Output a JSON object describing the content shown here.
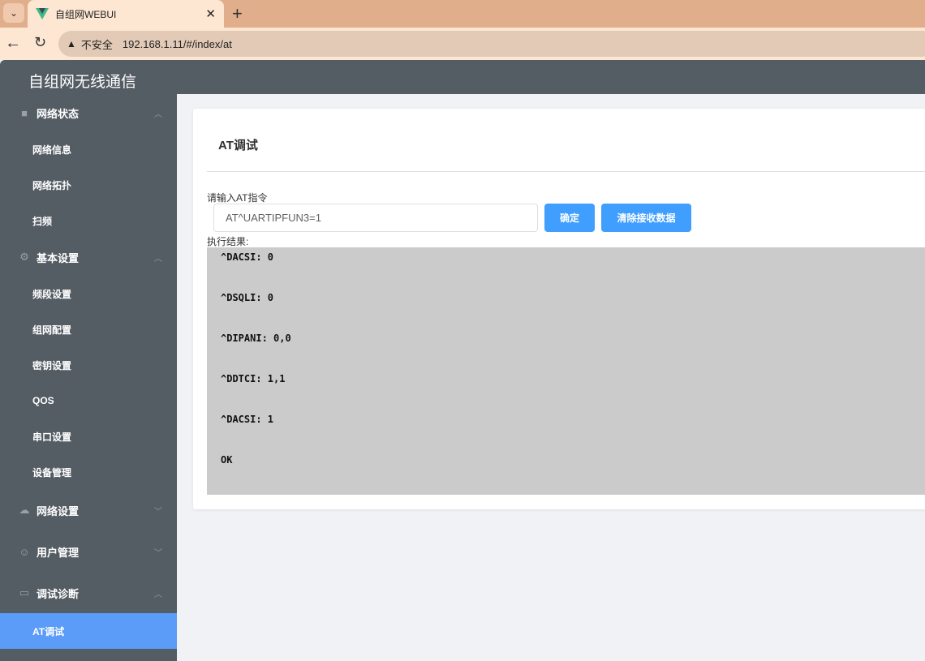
{
  "browser": {
    "tab_title": "自组网WEBUI",
    "insecure_label": "不安全",
    "url": "192.168.1.11/#/index/at"
  },
  "app": {
    "title": "自组网无线通信"
  },
  "sidebar": {
    "groups": [
      {
        "label": "网络状态",
        "icon": "camera-icon",
        "expanded": true,
        "items": [
          "网络信息",
          "网络拓扑",
          "扫频"
        ]
      },
      {
        "label": "基本设置",
        "icon": "gear-icon",
        "expanded": true,
        "items": [
          "频段设置",
          "组网配置",
          "密钥设置",
          "QOS",
          "串口设置",
          "设备管理"
        ]
      },
      {
        "label": "网络设置",
        "icon": "cloud-upload-icon",
        "expanded": false,
        "items": []
      },
      {
        "label": "用户管理",
        "icon": "user-icon",
        "expanded": false,
        "items": []
      },
      {
        "label": "调试诊断",
        "icon": "monitor-icon",
        "expanded": true,
        "items": [
          "AT调试"
        ]
      }
    ],
    "active": "AT调试"
  },
  "main": {
    "title": "AT调试",
    "input_label": "请输入AT指令",
    "input_value": "AT^UARTIPFUN3=1",
    "confirm_label": "确定",
    "clear_label": "清除接收数据",
    "result_label": "执行结果:",
    "result_lines": [
      "^DACSI: 0",
      "^DSQLI: 0",
      "^DIPANI: 0,0",
      "^DDTCI: 1,1",
      "^DACSI: 1",
      "OK"
    ]
  },
  "colors": {
    "sidebar": "#545c64",
    "active": "#5a9cf8",
    "primary": "#409eff"
  }
}
